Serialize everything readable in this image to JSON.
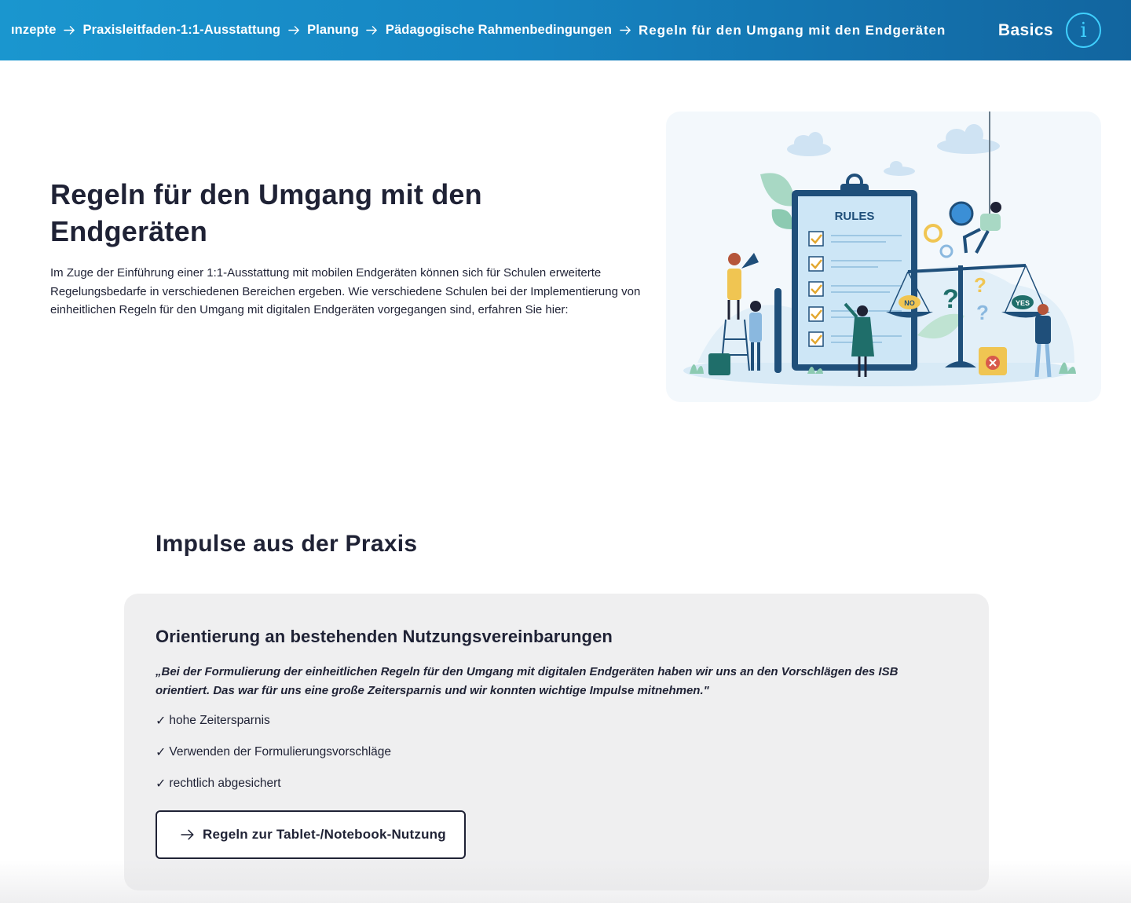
{
  "header": {
    "breadcrumbs": [
      {
        "label": "ınzepte"
      },
      {
        "label": "Praxisleitfaden-1:1-Ausstattung"
      },
      {
        "label": "Planung"
      },
      {
        "label": "Pädagogische Rahmenbedingungen"
      },
      {
        "label": "Regeln für den Umgang mit den Endgeräten"
      }
    ],
    "basics_label": "Basics",
    "info_icon": "info-icon",
    "colors": {
      "bar_start": "#1a96cf",
      "bar_end": "#12659f",
      "info_accent": "#3fd0ff"
    }
  },
  "hero": {
    "title": "Regeln für den Umgang mit den Endgeräten",
    "text": "Im Zuge der Einführung einer 1:1-Ausstattung mit mobilen Endgeräten können sich für Schulen erweiterte Regelungsbedarfe in verschiedenen Bereichen ergeben. Wie verschiedene Schulen bei der Implementierung von einheitlichen Regeln für den Umgang mit digitalen Endgeräten vorgegangen sind, erfahren Sie hier:",
    "illustration": {
      "clipboard_label": "RULES",
      "scale_left_label": "NO",
      "scale_right_label": "YES"
    }
  },
  "impulse": {
    "title": "Impulse aus der Praxis",
    "card": {
      "title": "Orientierung an bestehenden Nutzungsvereinbarungen",
      "quote": "„Bei der Formulierung der einheitlichen Regeln für den Umgang mit digitalen Endgeräten haben wir uns an den Vorschlägen des ISB orientiert. Das war für uns eine große Zeitersparnis und wir konnten wichtige Impulse mitnehmen.\"",
      "checks": [
        {
          "label": "hohe Zeitersparnis"
        },
        {
          "label": "Verwenden der Formulierungsvorschläge"
        },
        {
          "label": "rechtlich abgesichert"
        }
      ],
      "button_label": "Regeln zur Tablet-/Notebook-Nutzung"
    }
  }
}
